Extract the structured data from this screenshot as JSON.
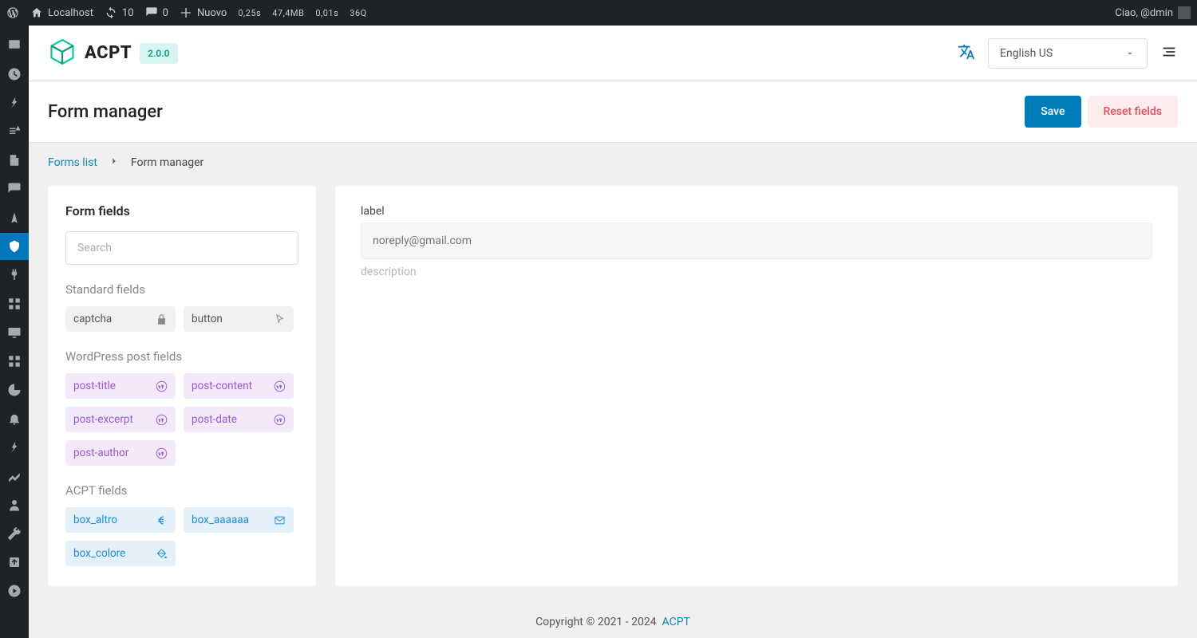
{
  "adminbar": {
    "site": "Localhost",
    "updates": "10",
    "comments": "0",
    "new": "Nuovo",
    "timing": "0,25s",
    "memory": "47,4MB",
    "query_time": "0,01s",
    "queries": "36Q",
    "greeting": "Ciao, @dmin"
  },
  "brand": {
    "name": "ACPT",
    "version": "2.0.0"
  },
  "topbar": {
    "language": "English US"
  },
  "page": {
    "title": "Form manager",
    "save": "Save",
    "reset": "Reset fields"
  },
  "breadcrumb": {
    "root": "Forms list",
    "current": "Form manager"
  },
  "sidebar": {
    "title": "Form fields",
    "search_placeholder": "Search",
    "standard_label": "Standard fields",
    "standard_fields": [
      "captcha",
      "button"
    ],
    "wp_label": "WordPress post fields",
    "wp_fields": [
      "post-title",
      "post-content",
      "post-excerpt",
      "post-date",
      "post-author"
    ],
    "acpt_label": "ACPT fields",
    "acpt_fields": [
      "box_altro",
      "box_aaaaaa",
      "box_colore"
    ]
  },
  "canvas": {
    "label": "label",
    "placeholder": "noreply@gmail.com",
    "description": "description"
  },
  "footer": {
    "copyright": "Copyright © 2021 - 2024",
    "link": "ACPT"
  }
}
